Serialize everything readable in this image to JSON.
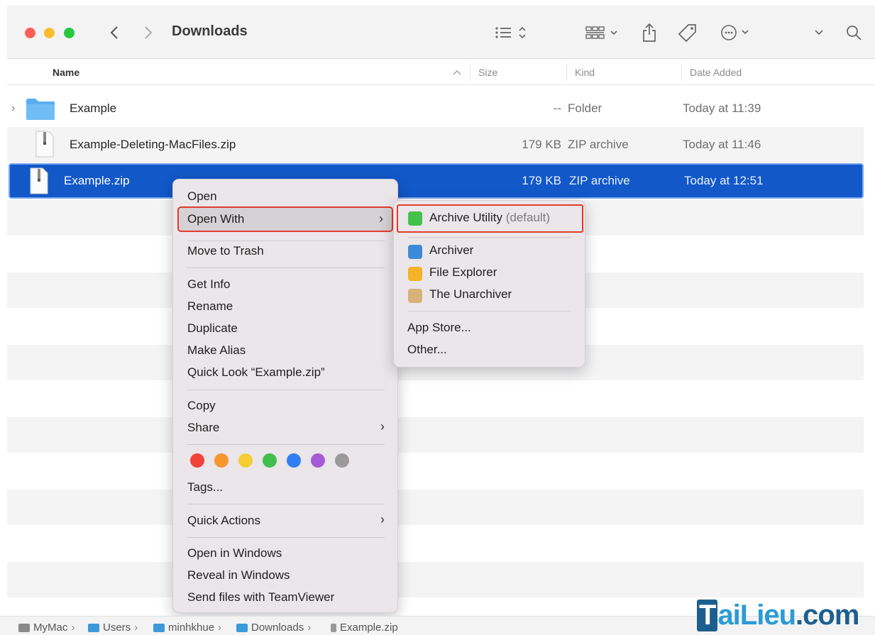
{
  "window": {
    "title": "Downloads"
  },
  "columns": {
    "name": "Name",
    "size": "Size",
    "kind": "Kind",
    "date": "Date Added"
  },
  "files": [
    {
      "name": "Example",
      "size": "--",
      "kind": "Folder",
      "date": "Today at 11:39",
      "icon": "folder-icon"
    },
    {
      "name": "Example-Deleting-MacFiles.zip",
      "size": "179 KB",
      "kind": "ZIP archive",
      "date": "Today at 11:46",
      "icon": "zip-file-icon"
    },
    {
      "name": "Example.zip",
      "size": "179 KB",
      "kind": "ZIP archive",
      "date": "Today at 12:51",
      "icon": "zip-file-icon",
      "selected": true
    }
  ],
  "context_menu": {
    "open": "Open",
    "open_with": "Open With",
    "move_to_trash": "Move to Trash",
    "get_info": "Get Info",
    "rename": "Rename",
    "duplicate": "Duplicate",
    "make_alias": "Make Alias",
    "quick_look": "Quick Look “Example.zip”",
    "copy": "Copy",
    "share": "Share",
    "tags": "Tags...",
    "quick_actions": "Quick Actions",
    "open_in_windows": "Open in Windows",
    "reveal_in_windows": "Reveal in Windows",
    "send_files_teamviewer": "Send files with TeamViewer",
    "tag_colors": [
      "#f0433a",
      "#f7962f",
      "#f6cd32",
      "#3fbf4d",
      "#2f7ff0",
      "#a55bd6",
      "#9a9a9a"
    ]
  },
  "open_with_menu": {
    "archive_utility": "Archive Utility",
    "archive_utility_default": "(default)",
    "archiver": "Archiver",
    "file_explorer": "File Explorer",
    "the_unarchiver": "The Unarchiver",
    "app_store": "App Store...",
    "other": "Other..."
  },
  "pathbar": {
    "items": [
      "MyMac",
      "Users",
      "minhkhue",
      "Downloads",
      "Example.zip"
    ]
  },
  "watermark": {
    "logo_first": "T",
    "logo_mid": "aiLieu",
    "logo_end": ".com"
  },
  "colors": {
    "selection": "#1258c9",
    "highlight_border": "#e23b2e"
  }
}
